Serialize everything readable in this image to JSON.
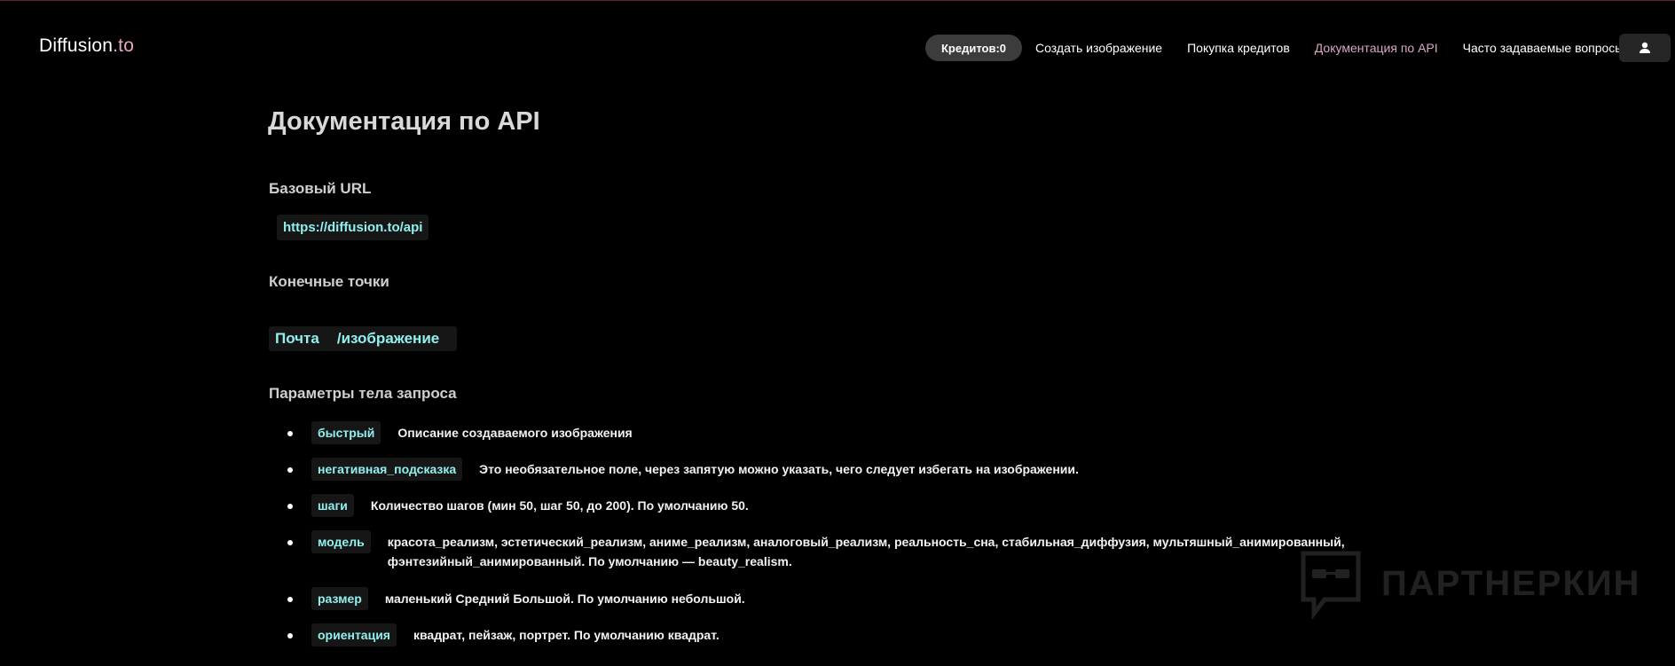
{
  "header": {
    "logo_part1": "Diffusion",
    "logo_part2": ".to",
    "credits_label": "Кредитов:0",
    "nav": [
      {
        "label": "Создать изображение"
      },
      {
        "label": "Покупка кредитов"
      },
      {
        "label": "Документация по API"
      },
      {
        "label": "Часто задаваемые вопросы"
      }
    ],
    "active_nav": "Документация по API",
    "user_icon": "user-icon"
  },
  "main": {
    "title": "Документация по API",
    "base_url_heading": "Базовый URL",
    "base_url": "https://diffusion.to/api",
    "endpoints_heading": "Конечные точки",
    "endpoint": {
      "method": "Почта",
      "path": "/изображение"
    },
    "params_heading": "Параметры тела запроса",
    "params": [
      {
        "name": "быстрый",
        "desc": "Описание создаваемого изображения"
      },
      {
        "name": "негативная_подсказка",
        "desc": "Это необязательное поле, через запятую можно указать, чего следует избегать на изображении."
      },
      {
        "name": "шаги",
        "desc": "Количество шагов (мин 50, шаг 50, до 200). По умолчанию 50."
      },
      {
        "name": "модель",
        "desc": "красота_реализм, эстетический_реализм, аниме_реализм, аналоговый_реализм, реальность_сна, стабильная_диффузия, мультяшный_анимированный, фэнтезийный_анимированный. По умолчанию — beauty_realism."
      },
      {
        "name": "размер",
        "desc": "маленький Средний Большой. По умолчанию небольшой."
      },
      {
        "name": "ориентация",
        "desc": "квадрат, пейзаж, портрет. По умолчанию квадрат."
      }
    ]
  },
  "watermark": {
    "text": "ПАРТНЕРКИН",
    "icon": "chat-bubble-glasses-icon"
  },
  "colors": {
    "background": "#000000",
    "accent_pink": "#d8a7c4",
    "code_text": "#8ff0ee",
    "code_bg": "#161616",
    "credits_bg": "#3c3c3c"
  }
}
